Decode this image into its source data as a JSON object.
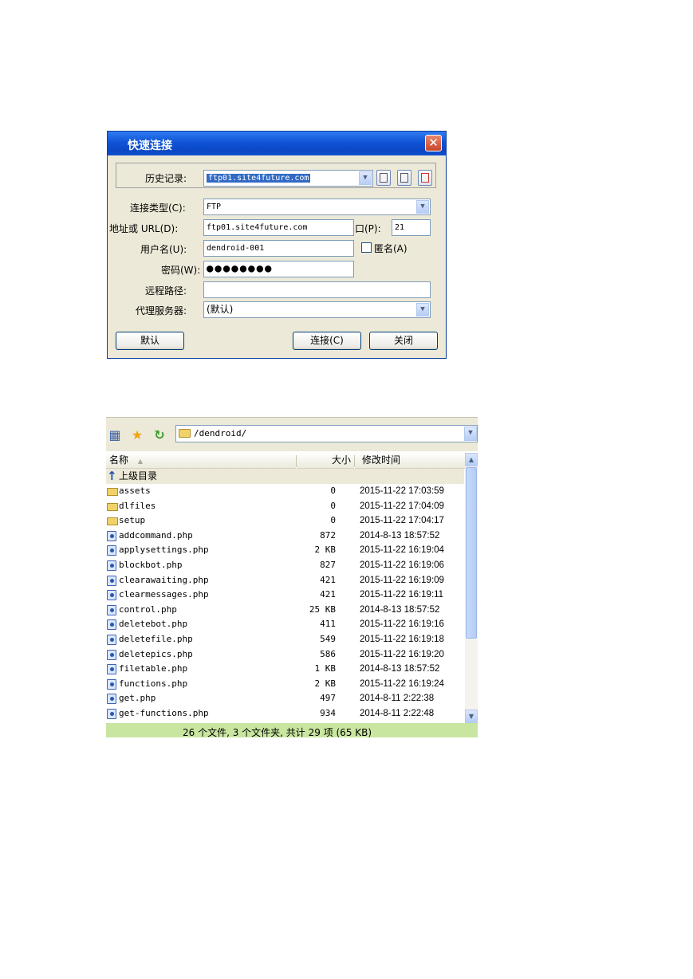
{
  "dialog": {
    "title": "快速连接",
    "close_glyph": "✕",
    "history_label": "历史记录:",
    "history_value": "ftp01.site4future.com",
    "connection_type_label": "连接类型(C):",
    "connection_type_value": "FTP",
    "address_label": "地址或 URL(D):",
    "address_value": "ftp01.site4future.com",
    "port_label": "口(P):",
    "port_value": "21",
    "username_label": "用户名(U):",
    "username_value": "dendroid-001",
    "anonymous_label": "匿名(A)",
    "password_label": "密码(W):",
    "password_value": "●●●●●●●●",
    "remote_path_label": "远程路径:",
    "remote_path_value": "",
    "proxy_label": "代理服务器:",
    "proxy_value": "(默认)",
    "default_button": "默认",
    "connect_button": "连接(C)",
    "close_button": "关闭"
  },
  "panel": {
    "address": "/dendroid/",
    "columns": {
      "name": "名称",
      "sort_glyph": "▲",
      "size": "大小",
      "modified": "修改时间"
    },
    "parent_dir_label": "上级目录",
    "files": [
      {
        "name": "assets",
        "size": "0",
        "modified": "2015-11-22 17:03:59",
        "type": "folder"
      },
      {
        "name": "dlfiles",
        "size": "0",
        "modified": "2015-11-22 17:04:09",
        "type": "folder"
      },
      {
        "name": "setup",
        "size": "0",
        "modified": "2015-11-22 17:04:17",
        "type": "folder"
      },
      {
        "name": "addcommand.php",
        "size": "872",
        "modified": "2014-8-13 18:57:52",
        "type": "php"
      },
      {
        "name": "applysettings.php",
        "size": "2 KB",
        "modified": "2015-11-22 16:19:04",
        "type": "php"
      },
      {
        "name": "blockbot.php",
        "size": "827",
        "modified": "2015-11-22 16:19:06",
        "type": "php"
      },
      {
        "name": "clearawaiting.php",
        "size": "421",
        "modified": "2015-11-22 16:19:09",
        "type": "php"
      },
      {
        "name": "clearmessages.php",
        "size": "421",
        "modified": "2015-11-22 16:19:11",
        "type": "php"
      },
      {
        "name": "control.php",
        "size": "25 KB",
        "modified": "2014-8-13 18:57:52",
        "type": "php"
      },
      {
        "name": "deletebot.php",
        "size": "411",
        "modified": "2015-11-22 16:19:16",
        "type": "php"
      },
      {
        "name": "deletefile.php",
        "size": "549",
        "modified": "2015-11-22 16:19:18",
        "type": "php"
      },
      {
        "name": "deletepics.php",
        "size": "586",
        "modified": "2015-11-22 16:19:20",
        "type": "php"
      },
      {
        "name": "filetable.php",
        "size": "1 KB",
        "modified": "2014-8-13 18:57:52",
        "type": "php"
      },
      {
        "name": "functions.php",
        "size": "2 KB",
        "modified": "2015-11-22 16:19:24",
        "type": "php"
      },
      {
        "name": "get.php",
        "size": "497",
        "modified": "2014-8-11 2:22:38",
        "type": "php"
      },
      {
        "name": "get-functions.php",
        "size": "934",
        "modified": "2014-8-11 2:22:48",
        "type": "php"
      }
    ],
    "status": "26 个文件, 3 个文件夹, 共计 29 项 (65 KB)"
  }
}
